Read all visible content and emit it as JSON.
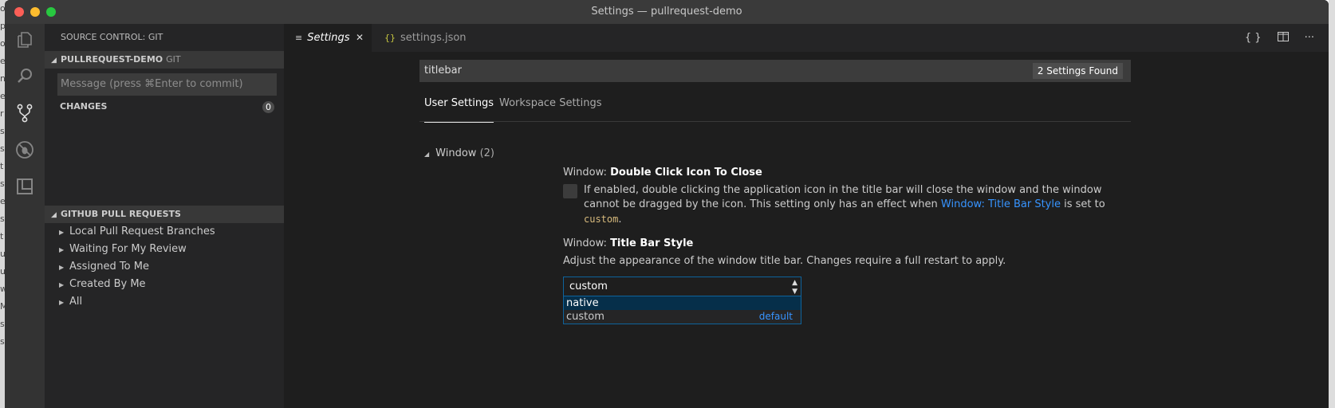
{
  "window": {
    "title": "Settings — pullrequest-demo"
  },
  "activity_bar": {
    "icons": [
      "explorer-icon",
      "search-icon",
      "source-control-icon",
      "debug-icon",
      "extensions-icon"
    ]
  },
  "sidebar": {
    "title": "SOURCE CONTROL: GIT",
    "repo": {
      "name": "PULLREQUEST-DEMO",
      "provider": "GIT"
    },
    "commit_placeholder": "Message (press ⌘Enter to commit)",
    "changes": {
      "label": "CHANGES",
      "count": "0"
    },
    "pull_requests": {
      "title": "GITHUB PULL REQUESTS",
      "items": [
        {
          "label": "Local Pull Request Branches"
        },
        {
          "label": "Waiting For My Review"
        },
        {
          "label": "Assigned To Me"
        },
        {
          "label": "Created By Me"
        },
        {
          "label": "All"
        }
      ]
    }
  },
  "tabs": [
    {
      "label": "Settings",
      "active": true
    },
    {
      "label": "settings.json",
      "active": false
    }
  ],
  "editor_actions": [
    "{ }",
    "split-editor-icon",
    "···"
  ],
  "settings": {
    "search_value": "titlebar",
    "found": "2 Settings Found",
    "scopes": {
      "user": "User Settings",
      "workspace": "Workspace Settings"
    },
    "toc": {
      "label": "Window",
      "count": "(2)"
    },
    "items": [
      {
        "category": "Window: ",
        "name": "Double Click Icon To Close",
        "desc_1": "If enabled, double clicking the application icon in the title bar will close the window and the window cannot be dragged by the icon. This setting only has an effect when ",
        "link": "Window: Title Bar Style",
        "desc_2": " is set to ",
        "code": "custom",
        "desc_3": "."
      },
      {
        "category": "Window: ",
        "name": "Title Bar Style",
        "desc": "Adjust the appearance of the window title bar. Changes require a full restart to apply.",
        "value": "custom",
        "options": [
          {
            "label": "native",
            "tag": ""
          },
          {
            "label": "custom",
            "tag": "default"
          }
        ]
      }
    ]
  },
  "colors": {
    "accent": "#0e639c",
    "link": "#3794ff"
  }
}
